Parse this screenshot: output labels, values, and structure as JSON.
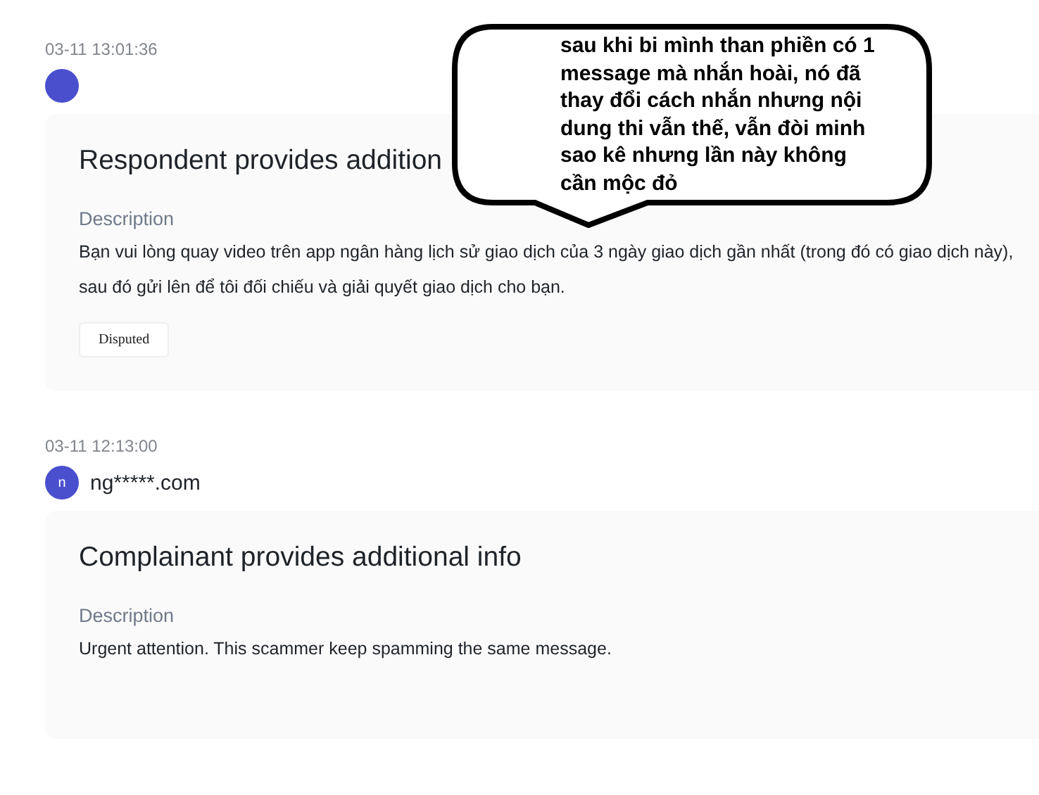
{
  "entries": [
    {
      "timestamp": "03-11 13:01:36",
      "avatar": {
        "kind": "dot"
      },
      "title": "Respondent provides addition",
      "description_label": "Description",
      "description": "Bạn vui lòng quay video trên app ngân hàng lịch sử giao dịch của 3 ngày giao dịch gần nhất (trong đó có giao dịch này), sau đó gửi lên để tôi đối chiếu và giải quyết giao dịch cho bạn.",
      "tag": "Disputed"
    },
    {
      "timestamp": "03-11 12:13:00",
      "avatar": {
        "kind": "letter",
        "letter": "n"
      },
      "user": "ng*****.com",
      "title": "Complainant provides additional info",
      "description_label": "Description",
      "description": "Urgent attention. This scammer keep spamming the same message."
    }
  ],
  "annotation": {
    "text": "sau khi bi mình than phiền có 1 message mà nhắn hoài, nó đã thay đổi cách nhắn nhưng nội dung thi vẫn thế, vẫn đòi minh sao kê nhưng lần này không cần mộc đỏ"
  }
}
